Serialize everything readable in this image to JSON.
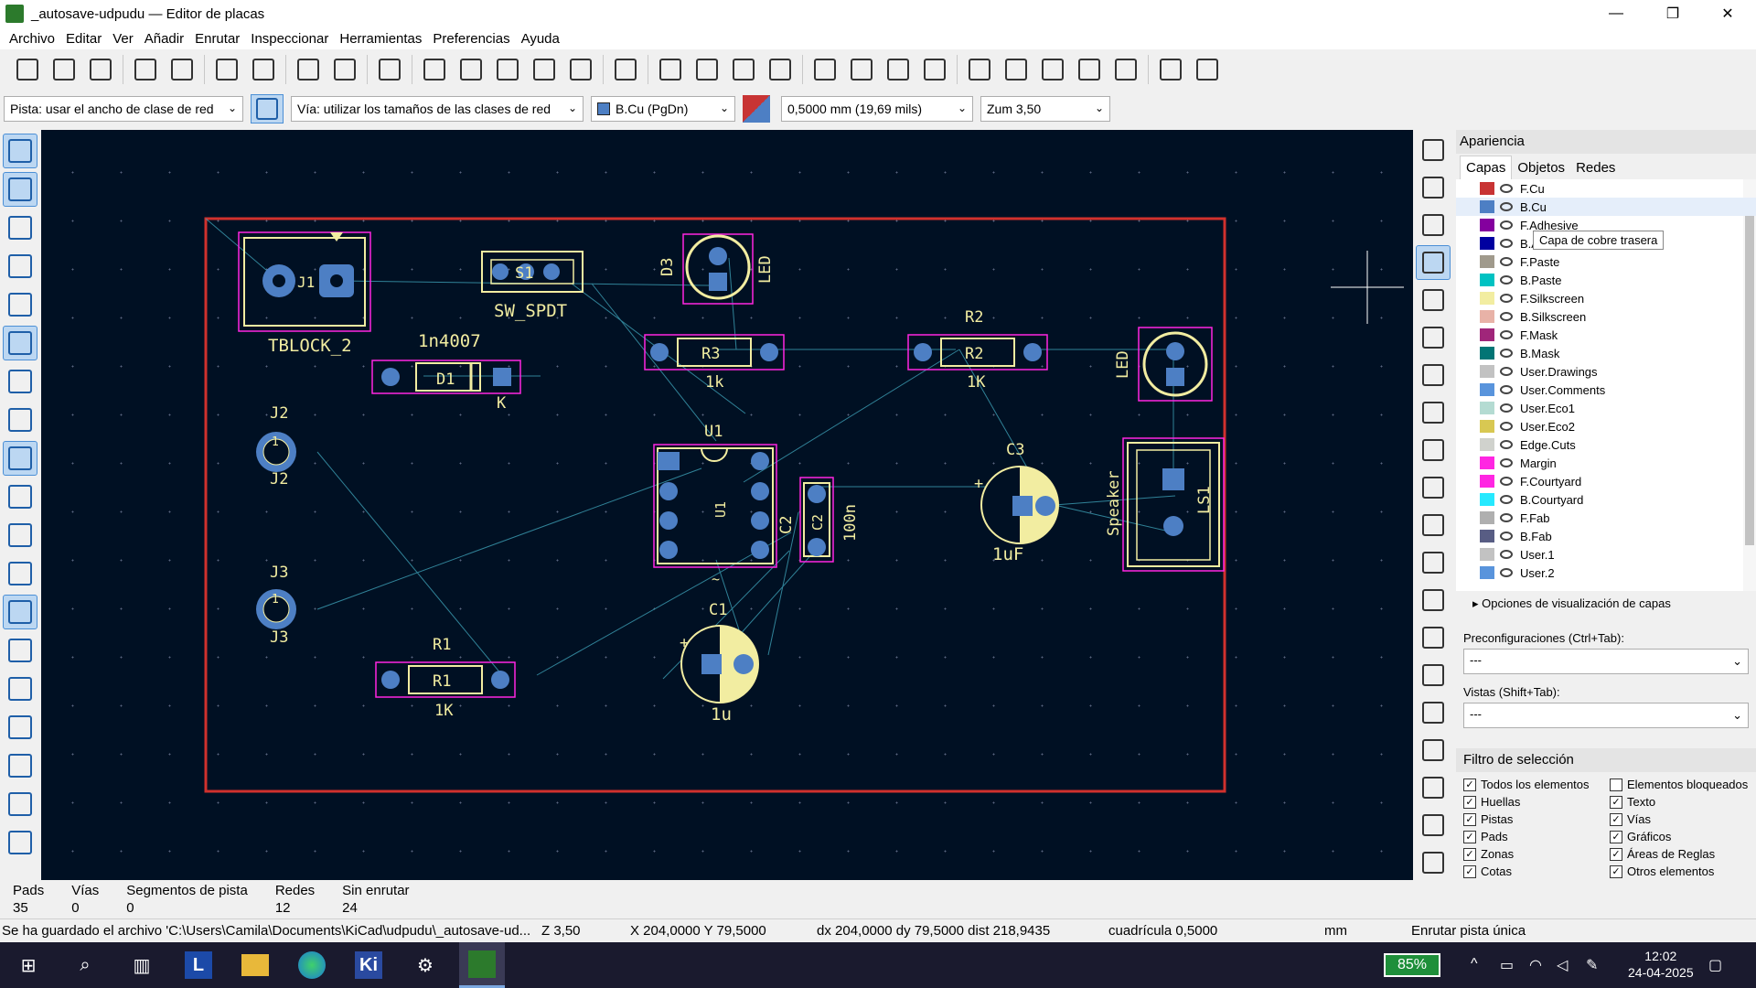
{
  "window": {
    "title": "_autosave-udpudu — Editor de placas",
    "minimize": "—",
    "restore": "❐",
    "close": "✕"
  },
  "menu": [
    "Archivo",
    "Editar",
    "Ver",
    "Añadir",
    "Enrutar",
    "Inspeccionar",
    "Herramientas",
    "Preferencias",
    "Ayuda"
  ],
  "toolbar_icons": [
    "new-board-icon",
    "open-icon",
    "save-icon",
    "board-setup-icon",
    "page-settings-icon",
    "print-icon",
    "plot-icon",
    "undo-icon",
    "redo-icon",
    "find-icon",
    "refresh-icon",
    "zoom-in-icon",
    "zoom-out-icon",
    "zoom-fit-icon",
    "zoom-objects-icon",
    "zoom-selection-icon",
    "rotate-ccw-icon",
    "rotate-cw-icon",
    "flip-icon",
    "mirror-icon",
    "group-icon",
    "ungroup-icon",
    "lock-icon",
    "unlock-icon",
    "update-pcb-icon",
    "footprint-editor-icon",
    "footprint-browser-icon",
    "netlist-icon",
    "drc-icon",
    "scripting-icon",
    "terminal-icon"
  ],
  "options": {
    "track": "Pista: usar el ancho de clase de red",
    "via": "Vía: utilizar los tamaños de las clases de red",
    "layer": "B.Cu (PgDn)",
    "grid": "0,5000 mm (19,69 mils)",
    "zoom": "Zum 3,50"
  },
  "left_tools": [
    "grid-dots-icon",
    "grid-overlay-icon",
    "polar-coords-icon",
    "inch-units-icon",
    "mil-units-icon",
    "mm-units-icon",
    "cursor-full-icon",
    "axis-icon",
    "ratsnest-icon",
    "curved-ratsnest-icon",
    "track-outline-icon",
    "via-outline-icon",
    "zone-fill-icon",
    "zone-outline-icon",
    "pad-outline-icon",
    "net-inspector-icon",
    "drc-marker-icon",
    "highlight-net-icon",
    "layer-manager-icon"
  ],
  "right_tools": [
    "select-icon",
    "local-ratsnest-icon",
    "footprint-icon",
    "route-track-icon",
    "tune-length-icon",
    "via-icon",
    "zone-icon",
    "rule-area-icon",
    "hatch-icon",
    "line-icon",
    "arc-icon",
    "rectangle-icon",
    "circle-icon",
    "polygon-icon",
    "bezier-icon",
    "image-icon",
    "text-icon",
    "textbox-icon",
    "table-icon",
    "dimension-icon"
  ],
  "panel": {
    "title": "Apariencia",
    "tabs": [
      "Capas",
      "Objetos",
      "Redes"
    ],
    "tooltip": "Capa de cobre trasera",
    "layers": [
      {
        "name": "F.Cu",
        "color": "#c83434"
      },
      {
        "name": "B.Cu",
        "color": "#4d7fc4"
      },
      {
        "name": "F.Adhesive",
        "color": "#84009e"
      },
      {
        "name": "B.Adhesive",
        "color": "#0000a0"
      },
      {
        "name": "F.Paste",
        "color": "#a09a8c"
      },
      {
        "name": "B.Paste",
        "color": "#00c2c2"
      },
      {
        "name": "F.Silkscreen",
        "color": "#f2eda1"
      },
      {
        "name": "B.Silkscreen",
        "color": "#e8b2a7"
      },
      {
        "name": "F.Mask",
        "color": "#a0267a"
      },
      {
        "name": "B.Mask",
        "color": "#027575"
      },
      {
        "name": "User.Drawings",
        "color": "#c2c2c2"
      },
      {
        "name": "User.Comments",
        "color": "#5994dc"
      },
      {
        "name": "User.Eco1",
        "color": "#b4dbd2"
      },
      {
        "name": "User.Eco2",
        "color": "#d8c852"
      },
      {
        "name": "Edge.Cuts",
        "color": "#d0d2cd"
      },
      {
        "name": "Margin",
        "color": "#ff26e2"
      },
      {
        "name": "F.Courtyard",
        "color": "#ff26e2"
      },
      {
        "name": "B.Courtyard",
        "color": "#26e9ff"
      },
      {
        "name": "F.Fab",
        "color": "#afafaf"
      },
      {
        "name": "B.Fab",
        "color": "#585d84"
      },
      {
        "name": "User.1",
        "color": "#c2c2c2"
      },
      {
        "name": "User.2",
        "color": "#5994dc"
      }
    ],
    "layer_options": "Opciones de visualización de capas",
    "presets_label": "Preconfiguraciones (Ctrl+Tab):",
    "presets_value": "---",
    "views_label": "Vistas (Shift+Tab):",
    "views_value": "---",
    "filter_title": "Filtro de selección",
    "filters_left": [
      "Todos los elementos",
      "Huellas",
      "Pistas",
      "Pads",
      "Zonas",
      "Cotas"
    ],
    "filters_right": [
      "Elementos bloqueados",
      "Texto",
      "Vías",
      "Gráficos",
      "Áreas de Reglas",
      "Otros elementos"
    ],
    "filters_left_checked": [
      true,
      true,
      true,
      true,
      true,
      true
    ],
    "filters_right_checked": [
      false,
      true,
      true,
      true,
      true,
      true
    ]
  },
  "pcb": {
    "board_edge_color": "#d0312d",
    "labels": {
      "j1_value": "TBLOCK_2",
      "sw_value": "SW_SPDT",
      "d3_ref": "D3",
      "d3_value": "LED",
      "d1_value": "1n4007",
      "d1_ref": "D1",
      "d1_k": "K",
      "r3_ref": "R3",
      "r3_value": "1k",
      "r2_ref": "R2",
      "r2_value": "1K",
      "r2_ref_top": "R2",
      "led2_value": "LED",
      "j2_ref": "J2",
      "j2_ref_b": "J2",
      "u1_ref": "U1",
      "u1_in": "U1",
      "c2_ref": "C2",
      "c2_in": "C2",
      "c2_value": "100n",
      "c3_ref": "C3",
      "c3_value": "1uF",
      "speaker": "Speaker",
      "ls1": "LS1",
      "j3_ref": "J3",
      "j3_ref_b": "J3",
      "c1_ref": "C1",
      "c1_value": "1u",
      "r1_ref": "R1",
      "r1_in": "R1",
      "r1_value": "1K",
      "j1_ref": "J1",
      "sw_ref": "S1",
      "tilde": "~",
      "plus": "+",
      "pin1": "1"
    }
  },
  "stats": [
    {
      "label": "Pads",
      "value": "35"
    },
    {
      "label": "Vías",
      "value": "0"
    },
    {
      "label": "Segmentos de pista",
      "value": "0"
    },
    {
      "label": "Redes",
      "value": "12"
    },
    {
      "label": "Sin enrutar",
      "value": "24"
    }
  ],
  "status": {
    "message": "Se ha guardado el archivo 'C:\\Users\\Camila\\Documents\\KiCad\\udpudu\\_autosave-ud...",
    "zoom": "Z 3,50",
    "coords": "X 204,0000  Y 79,5000",
    "delta": "dx 204,0000  dy 79,5000  dist 218,9435",
    "grid": "cuadrícula 0,5000",
    "units": "mm",
    "mode": "Enrutar pista única"
  },
  "taskbar": {
    "battery": "85%",
    "time": "12:02",
    "date": "24-04-2025"
  }
}
